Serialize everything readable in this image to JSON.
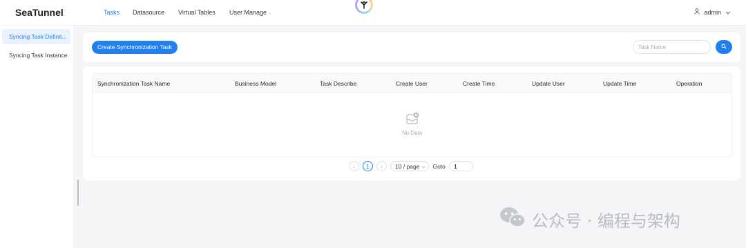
{
  "brand": "SeaTunnel",
  "nav": [
    {
      "label": "Tasks",
      "active": true
    },
    {
      "label": "Datasource",
      "active": false
    },
    {
      "label": "Virtual Tables",
      "active": false
    },
    {
      "label": "User Manage",
      "active": false
    }
  ],
  "user": {
    "name": "admin"
  },
  "sidebar": {
    "items": [
      {
        "label": "Syncing Task Definit...",
        "active": true
      },
      {
        "label": "Syncing Task Instance",
        "active": false
      }
    ]
  },
  "toolbar": {
    "create_label": "Create Synchronization Task",
    "search_placeholder": "Task Name"
  },
  "table": {
    "columns": [
      "Synchronization Task Name",
      "Business Model",
      "Task Describe",
      "Create User",
      "Create Time",
      "Update User",
      "Update Time",
      "Operation"
    ],
    "empty_text": "No Data"
  },
  "pagination": {
    "current_page": "1",
    "page_size": "10 / page",
    "goto_label": "Goto",
    "goto_value": "1"
  },
  "watermark": {
    "text": "公众号 · 编程与架构"
  },
  "colors": {
    "accent": "#2080f0",
    "background": "#f4f5f7"
  }
}
